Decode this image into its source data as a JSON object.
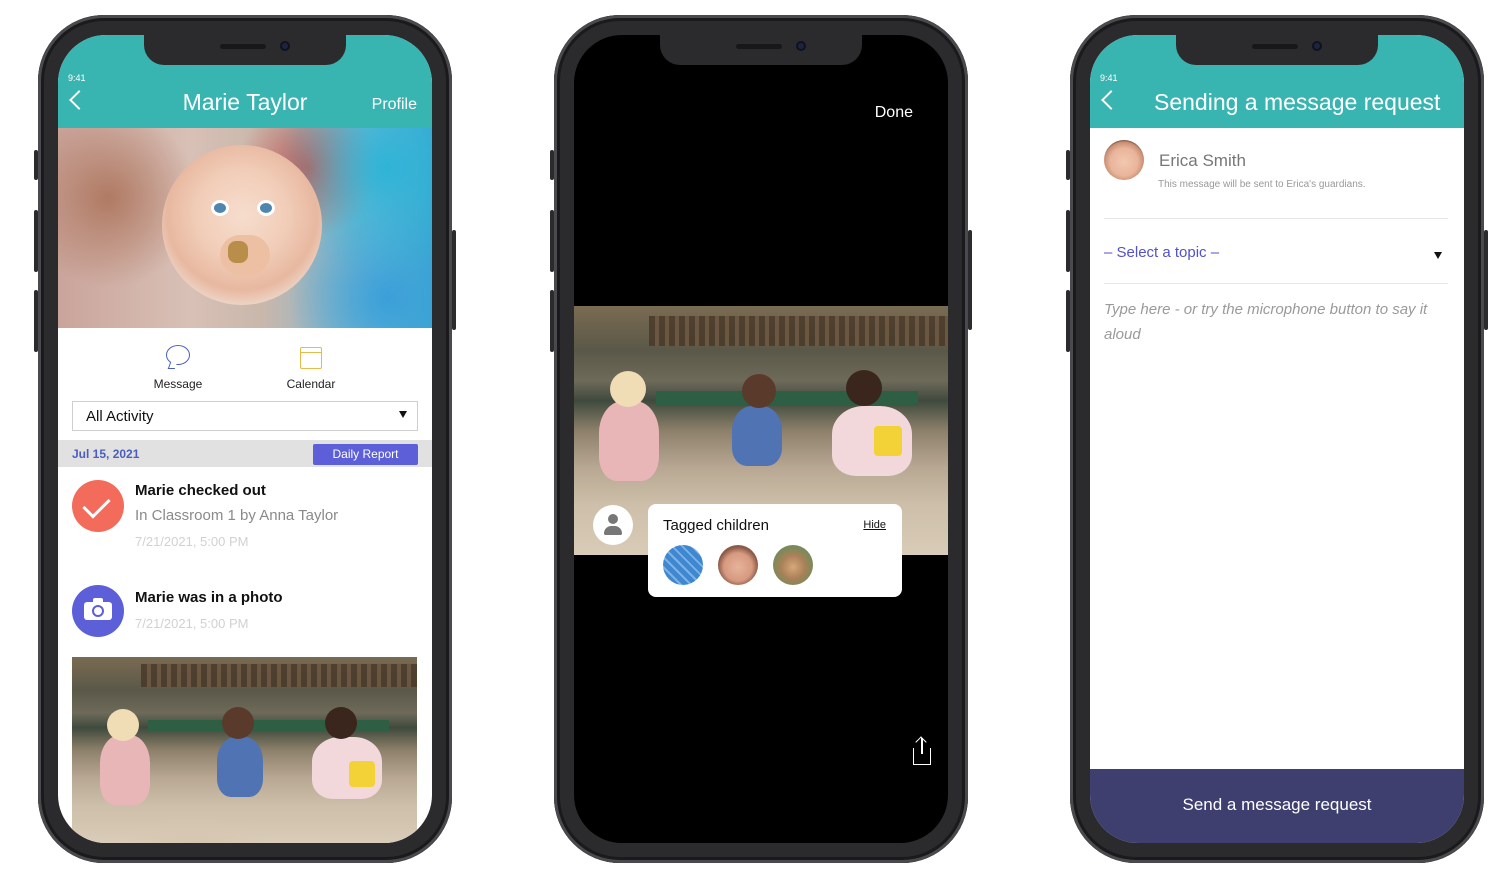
{
  "phone1": {
    "status_time": "9:41",
    "title": "Marie Taylor",
    "profile_link": "Profile",
    "actions": {
      "message": "Message",
      "calendar": "Calendar"
    },
    "filter": {
      "selected": "All Activity"
    },
    "date_band": {
      "date": "Jul 15, 2021",
      "daily_report": "Daily Report"
    },
    "feed": [
      {
        "title": "Marie checked out",
        "subtitle": "In Classroom 1 by Anna Taylor",
        "time": "7/21/2021, 5:00 PM",
        "icon": "check-icon",
        "color": "#f26b5b"
      },
      {
        "title": "Marie was in a photo",
        "time": "7/21/2021, 5:00 PM",
        "icon": "camera-icon",
        "color": "#5c5fd8"
      }
    ],
    "colors": {
      "header": "#39b5b1",
      "accent": "#5c5fd8"
    }
  },
  "phone2": {
    "done": "Done",
    "tagged": {
      "title": "Tagged children",
      "hide": "Hide"
    }
  },
  "phone3": {
    "status_time": "9:41",
    "title": "Sending a message request",
    "recipient": {
      "name": "Erica Smith",
      "note": "This message will be sent to Erica's guardians."
    },
    "topic_placeholder": "– Select a topic –",
    "message_placeholder": "Type here - or try the microphone button to say it aloud",
    "send_button": "Send a message request",
    "colors": {
      "header": "#39b5b1",
      "send": "#3e3f6e",
      "topic": "#5152c8"
    }
  }
}
